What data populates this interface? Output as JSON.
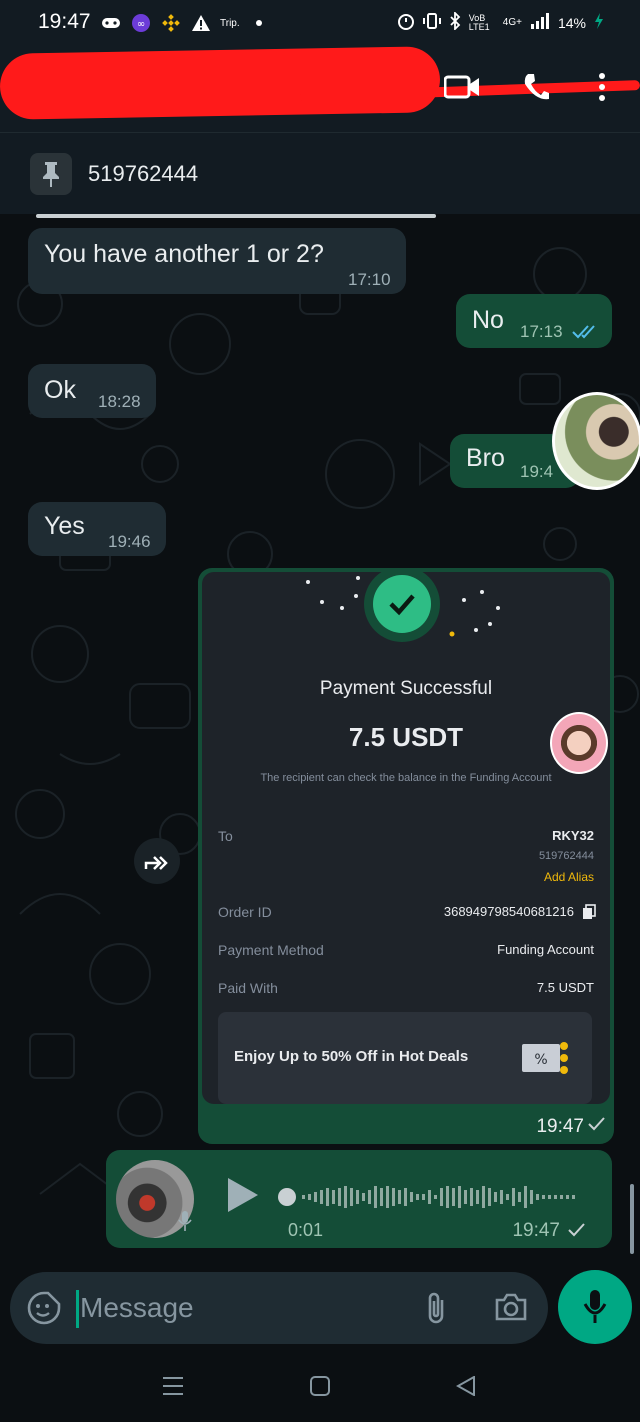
{
  "status_bar": {
    "time": "19:47",
    "trip_label": "Trip.",
    "battery": "14%",
    "network": "4G+",
    "volte": "VoB LTE1"
  },
  "pinned": {
    "text": "519762444"
  },
  "messages": [
    {
      "direction": "in",
      "text": "You have another 1 or 2?",
      "time": "17:10"
    },
    {
      "direction": "out",
      "text": "No",
      "time": "17:13"
    },
    {
      "direction": "in",
      "text": "Ok",
      "time": "18:28"
    },
    {
      "direction": "out",
      "text": "Bro",
      "time": "19:4"
    },
    {
      "direction": "in",
      "text": "Yes",
      "time": "19:46"
    }
  ],
  "payment": {
    "title": "Payment Successful",
    "amount": "7.5 USDT",
    "note": "The recipient can check the balance in the Funding Account",
    "to_label": "To",
    "to_name": "RKY32",
    "to_id": "519762444",
    "add_alias": "Add Alias",
    "order_label": "Order ID",
    "order_id": "368949798540681216",
    "method_label": "Payment Method",
    "method_value": "Funding Account",
    "paid_label": "Paid With",
    "paid_value": "7.5 USDT",
    "deal_text": "Enjoy Up to 50% Off in Hot Deals",
    "time": "19:47"
  },
  "voice": {
    "duration": "0:01",
    "time": "19:47"
  },
  "input": {
    "placeholder": "Message"
  },
  "colors": {
    "accent": "#00a884",
    "outgoing_bubble": "#144d37",
    "incoming_bubble": "#1f2c33",
    "binance_yellow": "#f0b90b",
    "success_green": "#2ebd85"
  }
}
